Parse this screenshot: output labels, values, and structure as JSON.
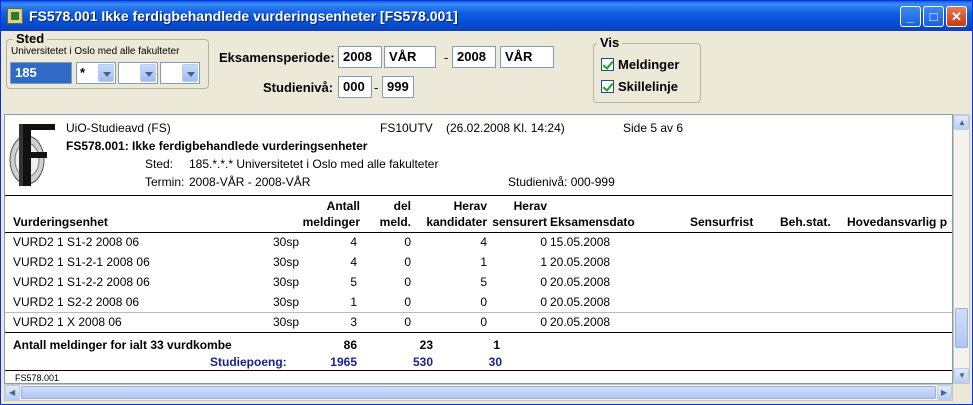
{
  "window": {
    "title": "FS578.001 Ikke ferdigbehandlede vurderingsenheter [FS578.001]",
    "minimize": "_",
    "maximize": "□",
    "close": "✕"
  },
  "sted": {
    "label": "Sted",
    "name": "Universitetet i Oslo med alle fakulteter",
    "code": "185",
    "combo1": "*",
    "combo2": "",
    "combo3": ""
  },
  "eksamen": {
    "label": "Eksamensperiode:",
    "from_year": "2008",
    "from_term": "VÅR",
    "sep": "-",
    "to_year": "2008",
    "to_term": "VÅR"
  },
  "studieniva": {
    "label": "Studienivå:",
    "from": "000",
    "sep": "-",
    "to": "999"
  },
  "vis": {
    "label": "Vis",
    "meldinger": "Meldinger",
    "skillelinje": "Skillelinje"
  },
  "report": {
    "org": "UiO-Studieavd (FS)",
    "code": "FS10UTV",
    "date": "(26.02.2008 Kl. 14:24)",
    "page": "Side 5 av 6",
    "title": "FS578.001: Ikke ferdigbehandlede vurderingsenheter",
    "sted_label": "Sted:",
    "sted_value": "185.*.*.* Universitetet i Oslo med alle fakulteter",
    "termin_label": "Termin:",
    "termin_value": "2008-VÅR - 2008-VÅR",
    "studieniva": "Studienivå: 000-999",
    "columns": {
      "vurd": "Vurderingsenhet",
      "antall1": "Antall",
      "antall2": "meldinger",
      "del1": "del",
      "del2": "meld.",
      "herav_k1": "Herav",
      "herav_k2": "kandidater",
      "herav_s1": "Herav",
      "herav_s2": "sensurert",
      "dato": "Eksamensdato",
      "frist": "Sensurfrist",
      "beh": "Beh.stat.",
      "hoved": "Hovedansvarlig p"
    },
    "rows": [
      {
        "vurd": "VURD2 1 S1-2 2008 06",
        "sp": "30sp",
        "antall": "4",
        "del": "0",
        "kand": "4",
        "sens": "0",
        "dato": "15.05.2008"
      },
      {
        "vurd": "VURD2 1 S1-2-1 2008 06",
        "sp": "30sp",
        "antall": "4",
        "del": "0",
        "kand": "1",
        "sens": "1",
        "dato": "20.05.2008"
      },
      {
        "vurd": "VURD2 1 S1-2-2 2008 06",
        "sp": "30sp",
        "antall": "5",
        "del": "0",
        "kand": "5",
        "sens": "0",
        "dato": "20.05.2008"
      },
      {
        "vurd": "VURD2 1 S2-2 2008 06",
        "sp": "30sp",
        "antall": "1",
        "del": "0",
        "kand": "0",
        "sens": "0",
        "dato": "20.05.2008"
      },
      {
        "vurd": "VURD2 1 X 2008 06",
        "sp": "30sp",
        "antall": "3",
        "del": "0",
        "kand": "0",
        "sens": "0",
        "dato": "20.05.2008"
      }
    ],
    "total_label": "Antall meldinger for ialt  33 vurdkombe",
    "total_antall": "86",
    "total_del": "23",
    "total_kand": "1",
    "sp_label": "Studiepoeng:",
    "sp_antall": "1965",
    "sp_del": "530",
    "sp_kand": "30",
    "footer": "FS578.001"
  }
}
